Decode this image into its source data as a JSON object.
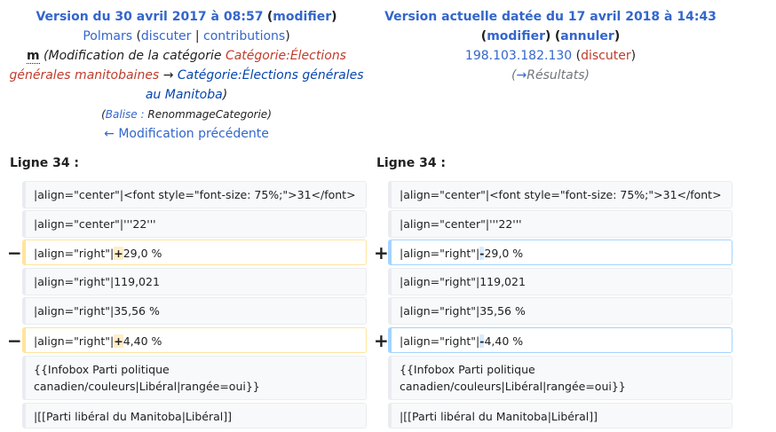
{
  "left_header": {
    "version_label": "Version du 30 avril 2017 à 08:57",
    "modify_label": "modifier",
    "user": "Polmars",
    "discuss": "discuter",
    "contributions": "contributions",
    "minor_mark": "m",
    "summary_prefix": "(Modification de la catégorie",
    "cat_old": "Catégorie:Élections générales manitobaines",
    "arrow": "→",
    "cat_new": "Catégorie:Élections générales au Manitoba",
    "summary_suffix": ")",
    "tag_open": "(",
    "tag_label": "Balise :",
    "tag_value": "RenommageCategorie",
    "tag_close": ")",
    "prev_edit": "← Modification précédente"
  },
  "right_header": {
    "version_label": "Version actuelle datée du 17 avril 2018 à 14:43",
    "modify_label": "modifier",
    "undo_label": "annuler",
    "ip": "198.103.182.130",
    "discuss": "discuter",
    "summary_open": "(",
    "summary_arrow": "→",
    "summary_section": "Résultats",
    "summary_close": ")"
  },
  "line_label_left": "Ligne 34 :",
  "line_label_right": "Ligne 34 :",
  "markers": {
    "minus": "−",
    "plus": "+"
  },
  "rows": [
    {
      "left": "|align=\"center\"|<font style=\"font-size: 75%;\">31</font>",
      "right": "|align=\"center\"|<font style=\"font-size: 75%;\">31</font>"
    },
    {
      "left": "|align=\"center\"|'''22'''",
      "right": "|align=\"center\"|'''22'''"
    },
    {
      "left_pre": "|align=\"right\"|",
      "left_hl": "+",
      "left_post": "29,0 %",
      "right_pre": "|align=\"right\"|",
      "right_hl": "-",
      "right_post": "29,0 %"
    },
    {
      "left": "|align=\"right\"|119,021",
      "right": "|align=\"right\"|119,021"
    },
    {
      "left": "|align=\"right\"|35,56 %",
      "right": "|align=\"right\"|35,56 %"
    },
    {
      "left_pre": "|align=\"right\"|",
      "left_hl": "+",
      "left_post": "4,40 %",
      "right_pre": "|align=\"right\"|",
      "right_hl": "-",
      "right_post": "4,40 %"
    },
    {
      "left": "{{Infobox Parti politique canadien/couleurs|Libéral|rangée=oui}}",
      "right": "{{Infobox Parti politique canadien/couleurs|Libéral|rangée=oui}}"
    },
    {
      "left": "|[[Parti libéral du Manitoba|Libéral]]",
      "right": "|[[Parti libéral du Manitoba|Libéral]]"
    }
  ]
}
